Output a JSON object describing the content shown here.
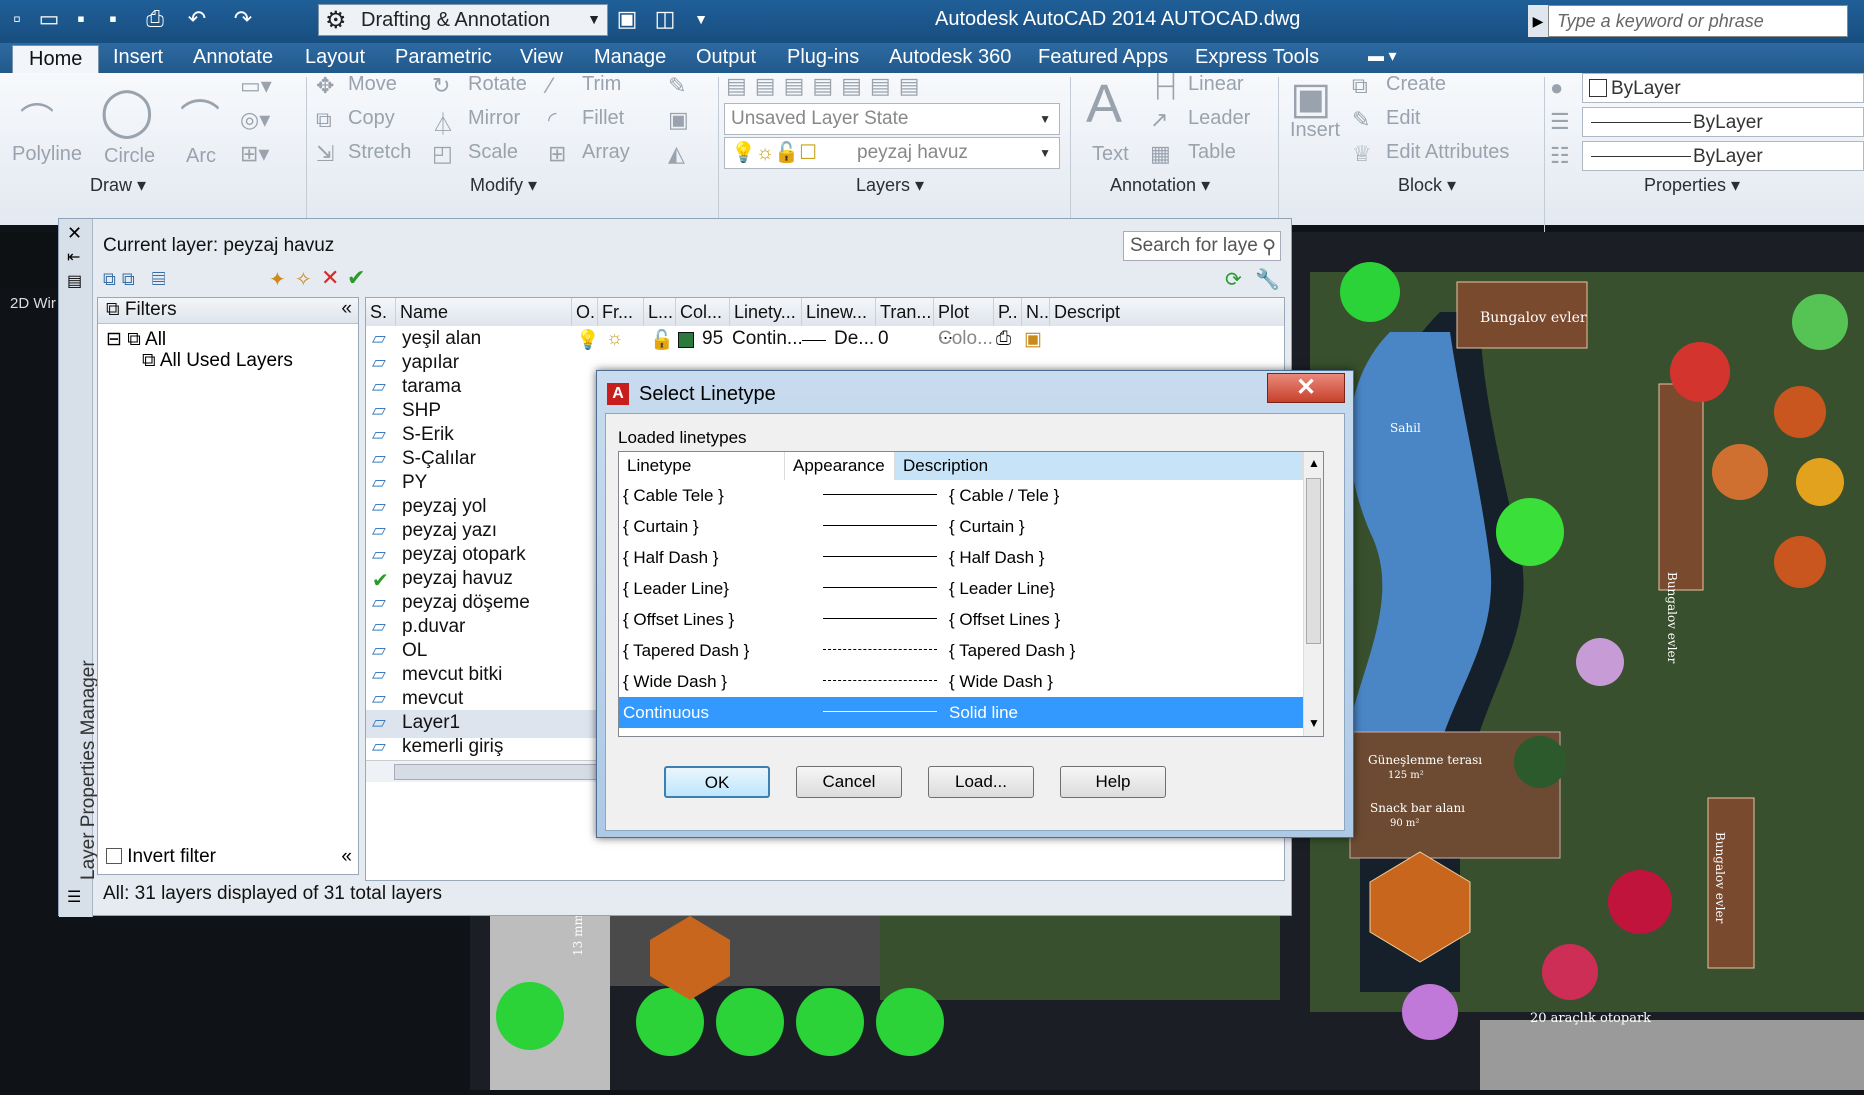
{
  "app": {
    "title": "Autodesk AutoCAD 2014    AUTOCAD.dwg",
    "workspace": "Drafting & Annotation",
    "search_placeholder": "Type a keyword or phrase"
  },
  "tabs": [
    "Home",
    "Insert",
    "Annotate",
    "Layout",
    "Parametric",
    "View",
    "Manage",
    "Output",
    "Plug-ins",
    "Autodesk 360",
    "Featured Apps",
    "Express Tools"
  ],
  "ribbon": {
    "draw": {
      "polyline": "Polyline",
      "circle": "Circle",
      "arc": "Arc",
      "panel": "Draw ▾"
    },
    "modify": {
      "move": "Move",
      "rotate": "Rotate",
      "trim": "Trim",
      "copy": "Copy",
      "mirror": "Mirror",
      "fillet": "Fillet",
      "stretch": "Stretch",
      "scale": "Scale",
      "array": "Array",
      "panel": "Modify ▾"
    },
    "layers": {
      "state": "Unsaved Layer State",
      "current": "peyzaj havuz",
      "panel": "Layers ▾"
    },
    "annotation": {
      "text": "Text",
      "linear": "Linear",
      "leader": "Leader",
      "table": "Table",
      "panel": "Annotation ▾"
    },
    "block": {
      "insert": "Insert",
      "create": "Create",
      "edit": "Edit",
      "edit_attributes": "Edit Attributes",
      "panel": "Block ▾"
    },
    "properties": {
      "color": "ByLayer",
      "linetype": "ByLayer",
      "lineweight": "ByLayer",
      "panel": "Properties ▾"
    }
  },
  "viewport_label": "2D Wir",
  "lpm": {
    "side_title": "Layer Properties Manager",
    "current_layer": "Current layer: peyzaj havuz",
    "search_placeholder": "Search for laye",
    "filters_header": "Filters",
    "filter_all": "All",
    "filter_used": "All Used Layers",
    "invert_filter": "Invert filter",
    "status": "All: 31 layers displayed of 31 total layers",
    "columns": [
      "S.",
      "Name",
      "O.",
      "Fr...",
      "L...",
      "Col...",
      "Linety...",
      "Linew...",
      "Tran...",
      "Plot ...",
      "P..",
      "N..",
      "Descript"
    ],
    "first_row": {
      "color_num": "95",
      "linetype": "Contin...",
      "lineweight": "De...",
      "transparency": "0",
      "plot_style": "Colo..."
    },
    "layers": [
      "yeşil alan",
      "yapılar",
      "tarama",
      "SHP",
      "S-Erik",
      "S-Çalılar",
      "PY",
      "peyzaj yol",
      "peyzaj yazı",
      "peyzaj otopark",
      "peyzaj havuz",
      "peyzaj döşeme",
      "p.duvar",
      "OL",
      "mevcut bitki",
      "mevcut",
      "Layer1",
      "kemerli giriş"
    ]
  },
  "dialog": {
    "title": "Select Linetype",
    "section_label": "Loaded linetypes",
    "columns": [
      "Linetype",
      "Appearance",
      "Description"
    ],
    "rows": [
      {
        "name": "{ Cable   Tele }",
        "desc": "{ Cable / Tele }"
      },
      {
        "name": "{ Curtain }",
        "desc": "{ Curtain }"
      },
      {
        "name": "{ Half Dash }",
        "desc": "{ Half Dash }"
      },
      {
        "name": "{ Leader Line}",
        "desc": "{ Leader Line}"
      },
      {
        "name": "{ Offset Lines }",
        "desc": "{ Offset Lines }"
      },
      {
        "name": "{ Tapered Dash }",
        "desc": "{ Tapered Dash }"
      },
      {
        "name": "{ Wide Dash }",
        "desc": "{ Wide Dash }"
      },
      {
        "name": "Continuous",
        "desc": "Solid line"
      }
    ],
    "buttons": {
      "ok": "OK",
      "cancel": "Cancel",
      "load": "Load...",
      "help": "Help"
    }
  },
  "drawing_labels": {
    "bungalov1": "Bungalov evler",
    "bungalov2": "Bungalov evler",
    "bungalov3": "Bungalov evler",
    "sahil": "Sahil",
    "gunes": "Güneşlenme terası",
    "gunes_area": "125 m²",
    "snack": "Snack bar alanı",
    "snack_area": "90 m²",
    "otopark": "20 araçlık otopark",
    "dim": "13 mm"
  }
}
